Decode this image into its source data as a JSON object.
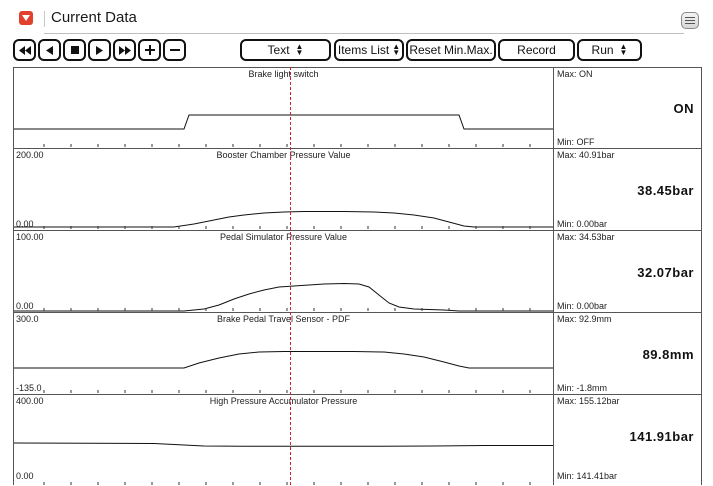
{
  "window": {
    "title": "Current Data"
  },
  "toolbar": {
    "text_select": "Text",
    "items_list": "Items List",
    "reset_minmax": "Reset Min.Max.",
    "record": "Record",
    "run": "Run"
  },
  "panels": [
    {
      "title": "Brake light switch",
      "scale_top": "",
      "scale_bottom": "",
      "max": "Max: ON",
      "min": "Min: OFF",
      "value": "ON"
    },
    {
      "title": "Booster Chamber Pressure Value",
      "scale_top": "200.00",
      "scale_bottom": "0.00",
      "max": "Max: 40.91bar",
      "min": "Min:  0.00bar",
      "value": "38.45bar"
    },
    {
      "title": "Pedal Simulator Pressure Value",
      "scale_top": "100.00",
      "scale_bottom": "0.00",
      "max": "Max: 34.53bar",
      "min": "Min:  0.00bar",
      "value": "32.07bar"
    },
    {
      "title": "Brake Pedal Travel Sensor - PDF",
      "scale_top": "300.0",
      "scale_bottom": "-135.0",
      "max": "Max:  92.9mm",
      "min": "Min:  -1.8mm",
      "value": "89.8mm"
    },
    {
      "title": "High Pressure Accumulator Pressure",
      "scale_top": "400.00",
      "scale_bottom": "0.00",
      "max": "Max: 155.12bar",
      "min": "Min: 141.41bar",
      "value": "141.91bar"
    }
  ],
  "colors": {
    "cursor": "#d0202a",
    "title_icon": "#e0402c"
  }
}
